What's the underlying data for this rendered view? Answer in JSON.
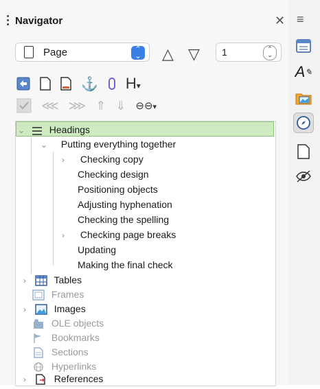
{
  "window": {
    "title": "Navigator"
  },
  "navigate_by": {
    "selected": "Page"
  },
  "page_number": "1",
  "toolbar": {
    "heading_label": "H"
  },
  "tree": {
    "headings": {
      "label": "Headings",
      "items": [
        {
          "label": "Putting everything together",
          "level": 1,
          "expandable": true,
          "expanded": true
        },
        {
          "label": "Checking copy",
          "level": 2,
          "expandable": true
        },
        {
          "label": "Checking design",
          "level": 2,
          "expandable": false
        },
        {
          "label": "Positioning objects",
          "level": 2,
          "expandable": false
        },
        {
          "label": "Adjusting hyphenation",
          "level": 2,
          "expandable": false
        },
        {
          "label": "Checking the spelling",
          "level": 2,
          "expandable": false
        },
        {
          "label": "Checking page breaks",
          "level": 2,
          "expandable": true
        },
        {
          "label": "Updating",
          "level": 2,
          "expandable": false
        },
        {
          "label": "Making the final check",
          "level": 2,
          "expandable": false
        }
      ]
    },
    "categories": [
      {
        "label": "Tables",
        "enabled": true,
        "expandable": true,
        "icon": "table-icon"
      },
      {
        "label": "Frames",
        "enabled": false,
        "expandable": false,
        "icon": "frame-icon"
      },
      {
        "label": "Images",
        "enabled": true,
        "expandable": true,
        "icon": "image-icon"
      },
      {
        "label": "OLE objects",
        "enabled": false,
        "expandable": false,
        "icon": "ole-icon"
      },
      {
        "label": "Bookmarks",
        "enabled": false,
        "expandable": false,
        "icon": "bookmark-icon"
      },
      {
        "label": "Sections",
        "enabled": false,
        "expandable": false,
        "icon": "section-icon"
      },
      {
        "label": "Hyperlinks",
        "enabled": false,
        "expandable": false,
        "icon": "hyperlink-icon"
      },
      {
        "label": "References",
        "enabled": true,
        "expandable": true,
        "icon": "reference-icon"
      }
    ]
  },
  "colors": {
    "selection": "#cdeac0",
    "accent": "#3a7fe6"
  }
}
